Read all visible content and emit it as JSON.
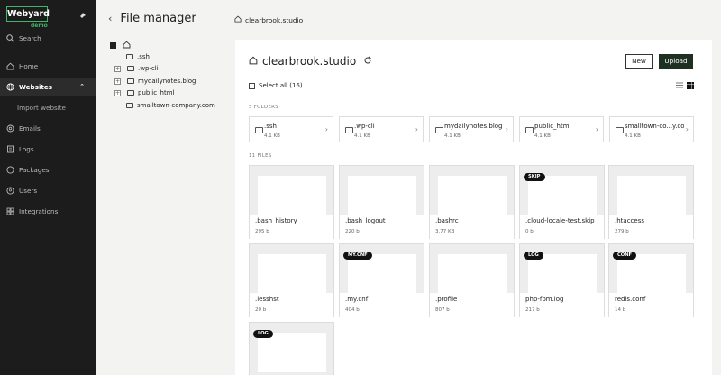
{
  "sidebar": {
    "logo": "Webyard",
    "logo_sub": "demo",
    "search": "Search",
    "items": [
      {
        "label": "Home"
      },
      {
        "label": "Websites"
      },
      {
        "label": "Import website"
      },
      {
        "label": "Emails"
      },
      {
        "label": "Logs"
      },
      {
        "label": "Packages"
      },
      {
        "label": "Users"
      },
      {
        "label": "Integrations"
      }
    ]
  },
  "tree": {
    "title": "File manager",
    "items": [
      ".ssh",
      ".wp-cli",
      "mydailynotes.blog",
      "public_html",
      "smalltown-company.com"
    ]
  },
  "breadcrumb": "clearbrook.studio",
  "main": {
    "title": "clearbrook.studio",
    "new_label": "New",
    "upload_label": "Upload",
    "select_all": "Select all (16)",
    "folders_label": "5 FOLDERS",
    "files_label": "11 FILES"
  },
  "folders": [
    {
      "name": ".ssh",
      "size": "4.1 KB"
    },
    {
      "name": ".wp-cli",
      "size": "4.1 KB"
    },
    {
      "name": "mydailynotes.blog",
      "size": "4.1 KB"
    },
    {
      "name": "public_html",
      "size": "4.1 KB"
    },
    {
      "name": "smalltown-co...y.com",
      "size": "4.1 KB"
    }
  ],
  "files": [
    {
      "name": ".bash_history",
      "size": "295 b",
      "tag": ""
    },
    {
      "name": ".bash_logout",
      "size": "220 b",
      "tag": ""
    },
    {
      "name": ".bashrc",
      "size": "3.77 KB",
      "tag": ""
    },
    {
      "name": ".cloud-locale-test.skip",
      "size": "0 b",
      "tag": "SKIP"
    },
    {
      "name": ".htaccess",
      "size": "279 b",
      "tag": ""
    },
    {
      "name": ".lesshst",
      "size": "20 b",
      "tag": ""
    },
    {
      "name": ".my.cnf",
      "size": "404 b",
      "tag": "MY.CNF"
    },
    {
      "name": ".profile",
      "size": "807 b",
      "tag": ""
    },
    {
      "name": "php-fpm.log",
      "size": "217 b",
      "tag": "LOG"
    },
    {
      "name": "redis.conf",
      "size": "14 b",
      "tag": "CONF"
    },
    {
      "name": "",
      "size": "",
      "tag": "LOG"
    }
  ]
}
